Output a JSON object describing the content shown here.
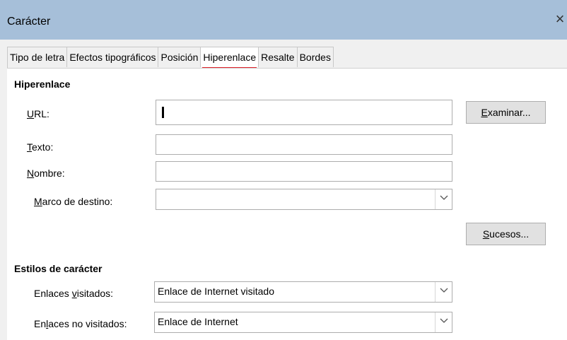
{
  "window": {
    "title": "Carácter",
    "close_label": "×"
  },
  "tabs": [
    {
      "label": "Tipo de letra"
    },
    {
      "label": "Efectos tipográficos"
    },
    {
      "label": "Posición"
    },
    {
      "label": "Hiperenlace",
      "active": true
    },
    {
      "label": "Resalte"
    },
    {
      "label": "Bordes"
    }
  ],
  "hyperlink": {
    "section_title": "Hiperenlace",
    "url_label_u": "U",
    "url_label_rest": "RL:",
    "url_value": "",
    "text_label_u": "T",
    "text_label_rest": "exto:",
    "text_value": "",
    "name_label_u": "N",
    "name_label_rest": "ombre:",
    "name_value": "",
    "target_label_u": "M",
    "target_label_rest": "arco de destino:",
    "target_value": "",
    "browse_u": "E",
    "browse_rest": "xaminar...",
    "events_u": "S",
    "events_rest": "ucesos..."
  },
  "char_styles": {
    "section_title": "Estilos de carácter",
    "visited_label_a": "Enlaces ",
    "visited_label_u": "v",
    "visited_label_b": "isitados:",
    "visited_value": "Enlace de Internet visitado",
    "unvisited_label_a": "En",
    "unvisited_label_u": "l",
    "unvisited_label_b": "aces no visitados:",
    "unvisited_value": "Enlace de Internet"
  }
}
